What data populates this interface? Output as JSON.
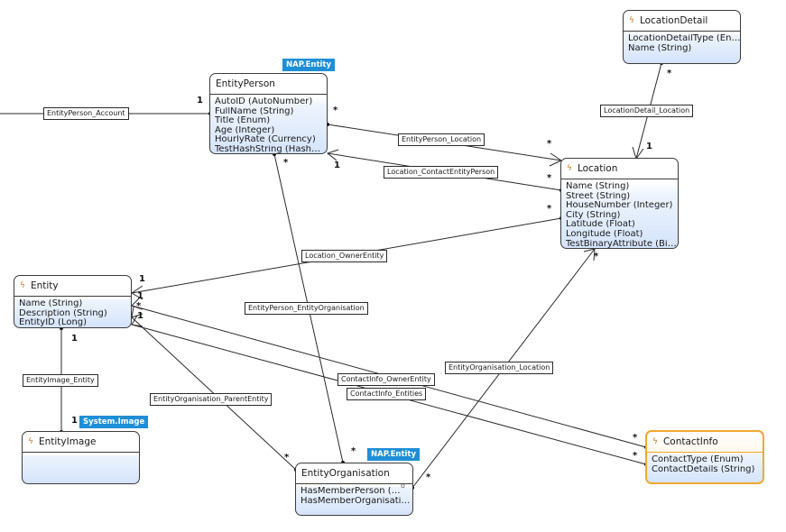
{
  "entities": {
    "entity_person": {
      "name": "EntityPerson",
      "tag": "NAP.Entity",
      "attributes": [
        "AutoID (AutoNumber)",
        "FullName (String)",
        "Title (Enum)",
        "Age (Integer)",
        "HourlyRate (Currency)",
        "TestHashString (Hash…"
      ]
    },
    "location_detail": {
      "name": "LocationDetail",
      "icon": "bolt-icon",
      "attributes": [
        "LocationDetailType (En…",
        "Name (String)"
      ]
    },
    "location": {
      "name": "Location",
      "icon": "bolt-icon",
      "attributes": [
        "Name (String)",
        "Street (String)",
        "HouseNumber (Integer)",
        "City (String)",
        "Latitude (Float)",
        "Longitude (Float)",
        "TestBinaryAttribute (Bi…"
      ]
    },
    "entity": {
      "name": "Entity",
      "icon": "bolt-icon",
      "attributes": [
        "Name (String)",
        "Description (String)",
        "EntityID (Long)"
      ]
    },
    "entity_image": {
      "name": "EntityImage",
      "icon": "bolt-icon",
      "tag": "System.Image",
      "attributes": []
    },
    "entity_organisation": {
      "name": "EntityOrganisation",
      "tag": "NAP.Entity",
      "attributes": [
        "HasMemberPerson (…",
        "HasMemberOrganisati…"
      ],
      "pin_glyph": "o"
    },
    "contact_info": {
      "name": "ContactInfo",
      "icon": "bolt-icon",
      "selected": true,
      "attributes": [
        "ContactType (Enum)",
        "ContactDetails (String)"
      ]
    }
  },
  "associations": {
    "entity_person_account": "EntityPerson_Account",
    "entity_person_location": "EntityPerson_Location",
    "location_contact_entity_person": "Location_ContactEntityPerson",
    "location_detail_location": "LocationDetail_Location",
    "location_owner_entity": "Location_OwnerEntity",
    "entity_person_entity_organisation": "EntityPerson_EntityOrganisation",
    "entity_image_entity": "EntityImage_Entity",
    "entity_organisation_parent_entity": "EntityOrganisation_ParentEntity",
    "contact_info_owner_entity": "ContactInfo_OwnerEntity",
    "contact_info_entities": "ContactInfo_Entities",
    "entity_organisation_location": "EntityOrganisation_Location"
  },
  "multiplicities": {
    "one": "1",
    "many": "*"
  }
}
